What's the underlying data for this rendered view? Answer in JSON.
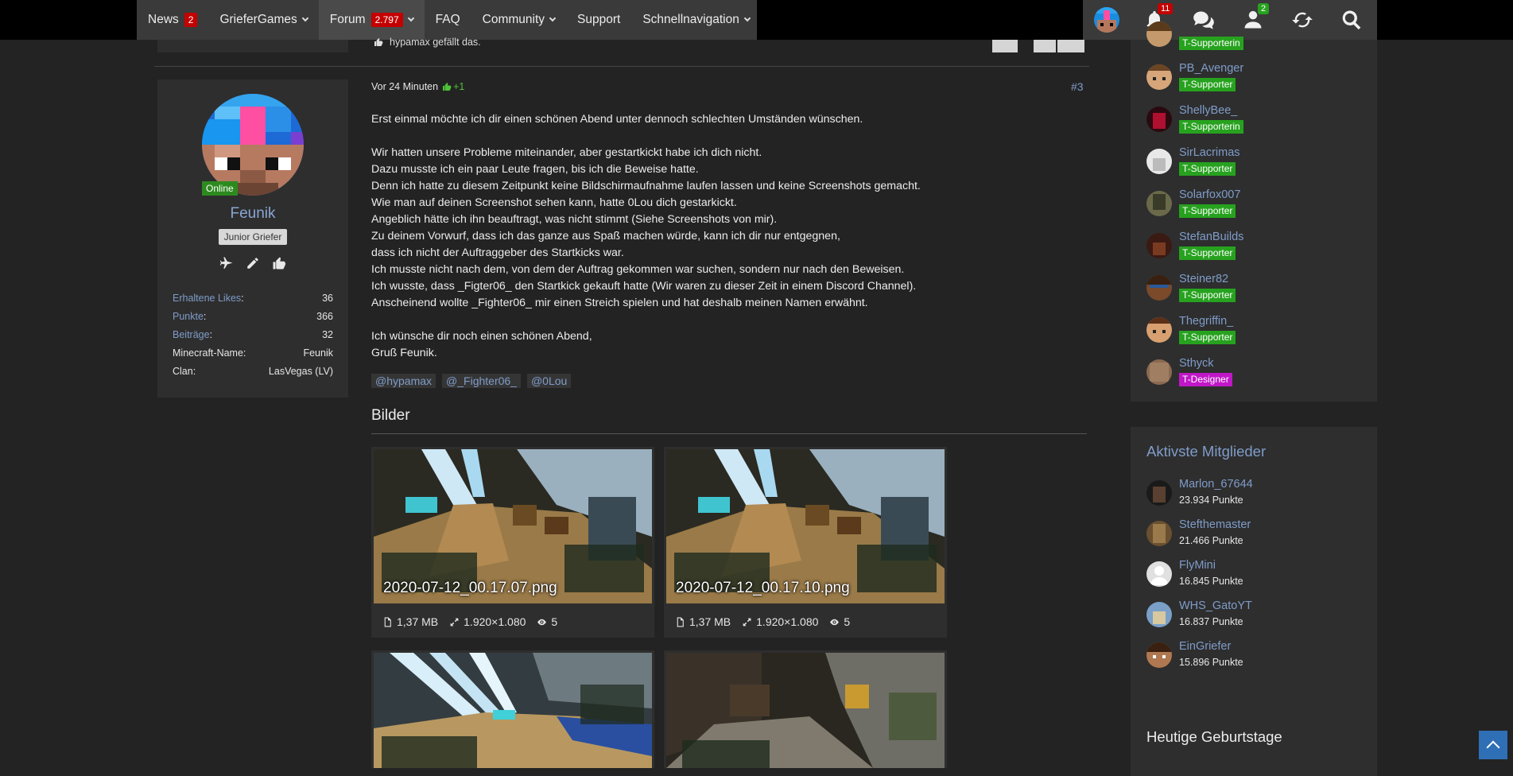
{
  "navbar": {
    "items": [
      {
        "label": "News",
        "badge": "2",
        "dropdown": false
      },
      {
        "label": "GrieferGames",
        "badge": "",
        "dropdown": true
      },
      {
        "label": "Forum",
        "badge": "2.797",
        "dropdown": true
      },
      {
        "label": "FAQ",
        "badge": "",
        "dropdown": false
      },
      {
        "label": "Community",
        "badge": "",
        "dropdown": true
      },
      {
        "label": "Support",
        "badge": "",
        "dropdown": false
      },
      {
        "label": "Schnellnavigation",
        "badge": "",
        "dropdown": true
      }
    ],
    "notifications_badge": "11",
    "friends_badge": "2"
  },
  "prev_post": {
    "liked_by": "hypamax gefällt das."
  },
  "author": {
    "status": "Online",
    "name": "Feunik",
    "rank": "Junior Griefer",
    "stats": [
      {
        "key": "Erhaltene Likes",
        "value": "36",
        "link": true
      },
      {
        "key": "Punkte",
        "value": "366",
        "link": true
      },
      {
        "key": "Beiträge",
        "value": "32",
        "link": true
      },
      {
        "key": "Minecraft-Name:",
        "value": "Feunik",
        "link": false
      },
      {
        "key": "Clan:",
        "value": "LasVegas (LV)",
        "link": false
      }
    ]
  },
  "post": {
    "time": "Vor 24 Minuten",
    "likes": "+1",
    "number": "#3",
    "lines": [
      "Erst einmal möchte ich dir einen schönen Abend unter dennoch schlechten Umständen wünschen.",
      "",
      "Wir hatten unsere Probleme miteinander, aber gestartkickt habe ich dich nicht.",
      "Dazu musste ich ein paar Leute fragen, bis ich die Beweise hatte.",
      "Denn ich hatte zu diesem Zeitpunkt keine Bildschirmaufnahme laufen lassen und keine Screenshots gemacht.",
      "Wie man auf deinen Screenshot sehen kann, hatte 0Lou dich gestarkickt.",
      "Angeblich hätte ich ihn beauftragt, was nicht stimmt (Siehe Screenshots von mir).",
      "Zu deinem Vorwurf, dass ich das ganze aus Spaß machen würde, kann ich dir nur entgegnen,",
      "dass ich nicht der Auftraggeber des Startkicks war.",
      "Ich musste nicht nach dem, von dem der Auftrag gekommen war suchen, sondern nur nach den Beweisen.",
      "Ich wusste, dass _Figter06_ den Startkick gekauft hatte (Wir waren zu dieser Zeit in einem Discord Channel).",
      "Anscheinend wollte _Fighter06_ mir einen Streich spielen und hat deshalb meinen Namen erwähnt.",
      "",
      "Ich wünsche dir noch einen schönen Abend,",
      "Gruß Feunik."
    ],
    "mentions": [
      "@hypamax",
      "@_Fighter06_",
      "@0Lou"
    ],
    "images_title": "Bilder",
    "attachments": [
      {
        "name": "2020-07-12_00.17.07.png",
        "size": "1,37 MB",
        "dims": "1.920×1.080",
        "views": "5"
      },
      {
        "name": "2020-07-12_00.17.10.png",
        "size": "1,37 MB",
        "dims": "1.920×1.080",
        "views": "5"
      },
      {
        "name": "",
        "size": "",
        "dims": "",
        "views": ""
      },
      {
        "name": "",
        "size": "",
        "dims": "",
        "views": ""
      }
    ]
  },
  "team": [
    {
      "name": "",
      "tag": "T-Supporterin",
      "color": "#27a21f"
    },
    {
      "name": "PB_Avenger",
      "tag": "T-Supporter",
      "color": "#27a21f"
    },
    {
      "name": "ShellyBee_",
      "tag": "T-Supporterin",
      "color": "#27a21f"
    },
    {
      "name": "SirLacrimas",
      "tag": "T-Supporter",
      "color": "#27a21f"
    },
    {
      "name": "Solarfox007",
      "tag": "T-Supporter",
      "color": "#27a21f"
    },
    {
      "name": "StefanBuilds",
      "tag": "T-Supporter",
      "color": "#27a21f"
    },
    {
      "name": "Steiner82",
      "tag": "T-Supporter",
      "color": "#27a21f"
    },
    {
      "name": "Thegriffin_",
      "tag": "T-Supporter",
      "color": "#27a21f"
    },
    {
      "name": "Sthyck",
      "tag": "T-Designer",
      "color": "#c017c7"
    }
  ],
  "active_members": {
    "title": "Aktivste Mitglieder",
    "items": [
      {
        "name": "Marlon_67644",
        "points": "23.934 Punkte"
      },
      {
        "name": "Stefthemaster",
        "points": "21.466 Punkte"
      },
      {
        "name": "FlyMini",
        "points": "16.845 Punkte"
      },
      {
        "name": "WHS_GatoYT",
        "points": "16.837 Punkte"
      },
      {
        "name": "EinGriefer",
        "points": "15.896 Punkte"
      }
    ]
  },
  "birthdays": {
    "title": "Heutige Geburtstage"
  },
  "colors": {
    "accent": "#7f9cc9",
    "badge_red": "#c40000",
    "supporter_green": "#27a21f",
    "designer_purple": "#c017c7",
    "online_green": "#2d8a1f",
    "scroll_top_blue": "#2f6fb5"
  }
}
